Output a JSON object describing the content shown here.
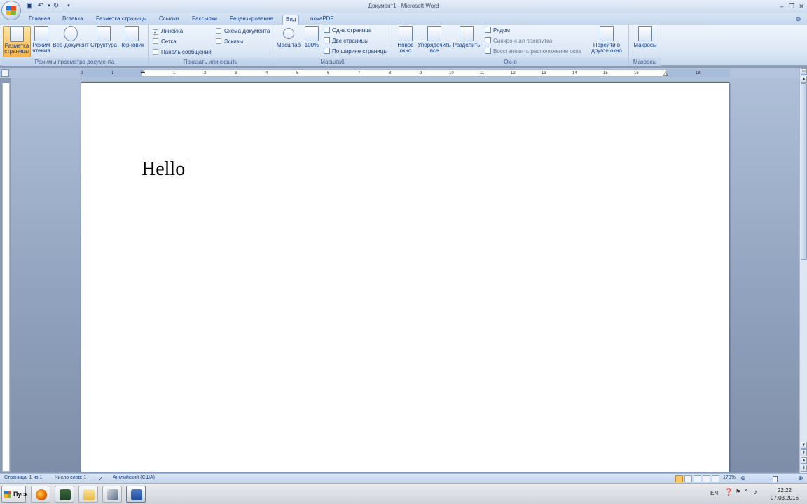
{
  "window": {
    "title": "Документ1 - Microsoft Word"
  },
  "tabs": [
    {
      "label": "Главная",
      "active": false
    },
    {
      "label": "Вставка",
      "active": false
    },
    {
      "label": "Разметка страницы",
      "active": false
    },
    {
      "label": "Ссылки",
      "active": false
    },
    {
      "label": "Рассылки",
      "active": false
    },
    {
      "label": "Рецензирование",
      "active": false
    },
    {
      "label": "Вид",
      "active": true
    },
    {
      "label": "novaPDF",
      "active": false
    }
  ],
  "ribbon": {
    "views_group": {
      "label": "Режимы просмотра документа",
      "buttons": [
        {
          "label1": "Разметка",
          "label2": "страницы",
          "selected": true
        },
        {
          "label1": "Режим",
          "label2": "чтения",
          "selected": false
        },
        {
          "label1": "Веб-документ",
          "label2": "",
          "selected": false
        },
        {
          "label1": "Структура",
          "label2": "",
          "selected": false
        },
        {
          "label1": "Черновик",
          "label2": "",
          "selected": false
        }
      ]
    },
    "show_group": {
      "label": "Показать или скрыть",
      "checkboxes": [
        {
          "label": "Линейка",
          "checked": true
        },
        {
          "label": "Сетка",
          "checked": false
        },
        {
          "label": "Панель сообщений",
          "checked": false
        },
        {
          "label": "Схема документа",
          "checked": false
        },
        {
          "label": "Эскизы",
          "checked": false
        }
      ]
    },
    "zoom_group": {
      "label": "Масштаб",
      "zoom_button": "Масштаб",
      "zoom100_button": "100%",
      "one_page": "Одна страница",
      "two_pages": "Две страницы",
      "page_width": "По ширине страницы"
    },
    "window_group": {
      "label": "Окно",
      "new_window1": "Новое",
      "new_window2": "окно",
      "arrange1": "Упорядочить",
      "arrange2": "все",
      "split": "Разделить",
      "side_by_side": "Рядом",
      "sync_scroll": "Синхронная прокрутка",
      "reset_position": "Восстановить расположение окна",
      "switch1": "Перейти в",
      "switch2": "другое окно"
    },
    "macros_group": {
      "label": "Макросы",
      "macros_button": "Макросы"
    }
  },
  "ruler": {
    "labels": [
      "2",
      "1",
      "1",
      "2",
      "3",
      "4",
      "5",
      "6",
      "7",
      "8",
      "9",
      "10",
      "11",
      "12",
      "13",
      "14",
      "15",
      "16",
      "18"
    ]
  },
  "document": {
    "text": "Hello"
  },
  "statusbar": {
    "page": "Страница: 1 из 1",
    "words": "Число слов: 1",
    "language": "Английский (США)",
    "zoom": "170%"
  },
  "taskbar": {
    "start_label": "Пуск",
    "lang": "EN",
    "time": "22:22",
    "date": "07.03.2016"
  },
  "colors": {
    "ribbon_top": "#eef4fc",
    "tab_text": "#15428b",
    "selected_view": "#f8b54a",
    "workspace": "#8ea0bb"
  }
}
